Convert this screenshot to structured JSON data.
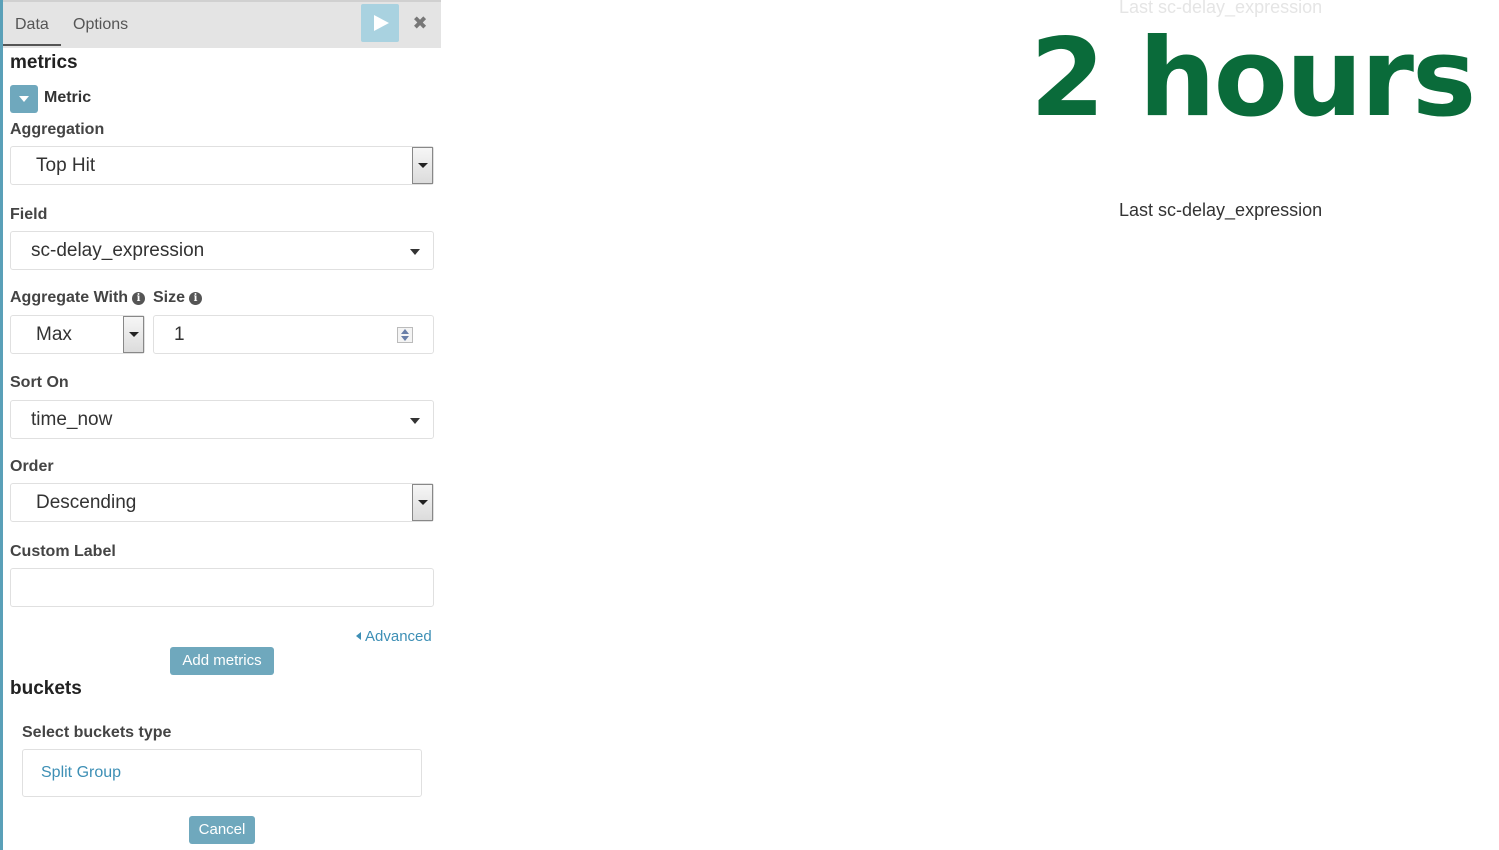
{
  "tabs": {
    "data": "Data",
    "options": "Options"
  },
  "icons": {
    "run": "play-icon",
    "close": "close-icon",
    "close_glyph": "✖",
    "info_glyph": "i"
  },
  "metrics": {
    "title": "metrics",
    "metric_label": "Metric",
    "aggregation": {
      "label": "Aggregation",
      "value": "Top Hit"
    },
    "field": {
      "label": "Field",
      "value": "sc-delay_expression"
    },
    "aggregate_with": {
      "label": "Aggregate With",
      "value": "Max"
    },
    "size": {
      "label": "Size",
      "value": "1"
    },
    "sort_on": {
      "label": "Sort On",
      "value": "time_now"
    },
    "order": {
      "label": "Order",
      "value": "Descending"
    },
    "custom_label": {
      "label": "Custom Label",
      "value": ""
    },
    "advanced": "Advanced",
    "add_button": "Add metrics"
  },
  "buckets": {
    "title": "buckets",
    "select_label": "Select buckets type",
    "option": "Split Group",
    "cancel": "Cancel"
  },
  "visualization": {
    "faded_label": "Last sc-delay_expression",
    "value": "2 hours",
    "label": "Last sc-delay_expression",
    "value_color": "#0a6b3a"
  },
  "colors": {
    "accent": "#6fa8bd",
    "link": "#3d8fb5"
  }
}
